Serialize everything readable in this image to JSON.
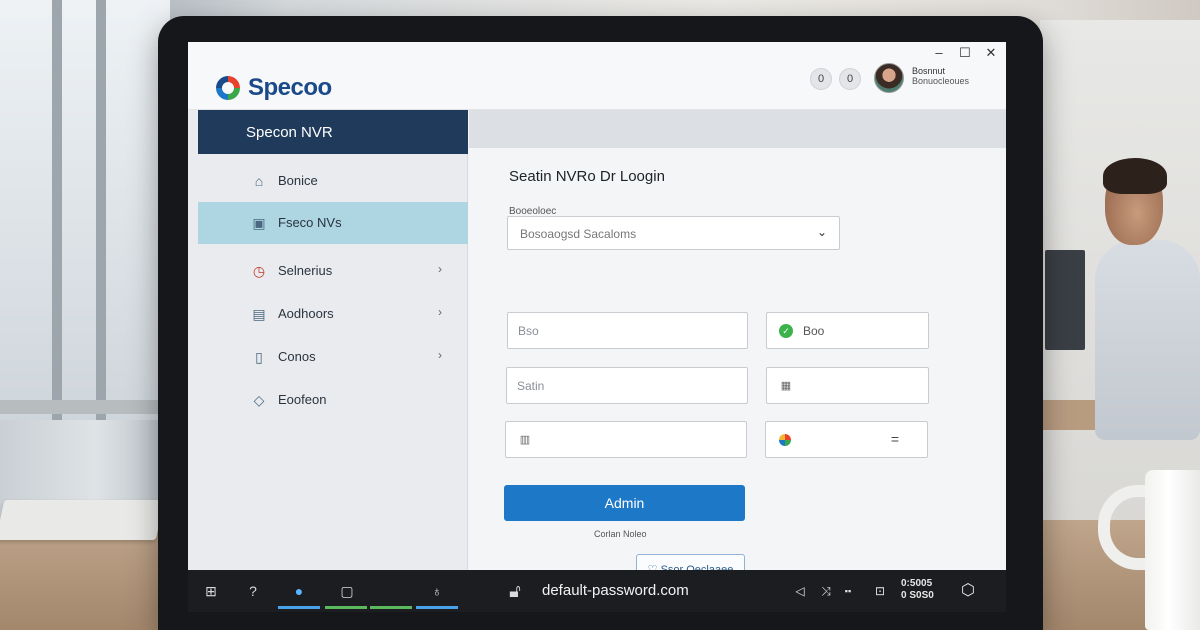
{
  "header": {
    "brand": "Specoo",
    "window_controls": {
      "minimize": "–",
      "maximize": "☐",
      "close": "✕"
    },
    "circle_buttons": [
      "0",
      "0"
    ],
    "user": {
      "name": "Bosnnut",
      "role": "Bonuocleoues"
    }
  },
  "sidebar": {
    "title": "Specon NVR",
    "items": [
      {
        "label": "Bonice",
        "icon": "home-icon",
        "glyph": "⌂",
        "chevron": ""
      },
      {
        "label": "Fseco NVs",
        "icon": "monitor-icon",
        "glyph": "▣",
        "chevron": "",
        "active": true
      },
      {
        "label": "Selnerius",
        "icon": "clock-icon",
        "glyph": "◷",
        "chevron": "›"
      },
      {
        "label": "Aodhoors",
        "icon": "document-icon",
        "glyph": "▤",
        "chevron": "›"
      },
      {
        "label": "Conos",
        "icon": "phone-icon",
        "glyph": "▯",
        "chevron": "›"
      },
      {
        "label": "Eoofeon",
        "icon": "location-icon",
        "glyph": "◇",
        "chevron": ""
      }
    ]
  },
  "main": {
    "title": "Seatin NVRo Dr Loogin",
    "select_label": "Booeoloec",
    "select_value": "Bosoaogsd Sacaloms",
    "fields": {
      "field1_placeholder": "Bso",
      "field2_text": "Boo",
      "field3_placeholder": "Satin",
      "field4_placeholder": "",
      "field5_placeholder": "",
      "field6_glyph": "="
    },
    "primary_button": "Admin",
    "small_link": "Corlan Noleo",
    "outline_button": "Ssor Oeclaaee"
  },
  "taskbar": {
    "url": "default-password.com",
    "tray_clock_top": "0:5005",
    "tray_clock_bottom": "0 S0S0"
  },
  "colors": {
    "brand_blue": "#1b4a8a",
    "sidebar_header": "#1f3a5a",
    "active_nav": "#add5e2",
    "primary_button": "#1e78c8",
    "taskbar": "#1b1d21"
  }
}
